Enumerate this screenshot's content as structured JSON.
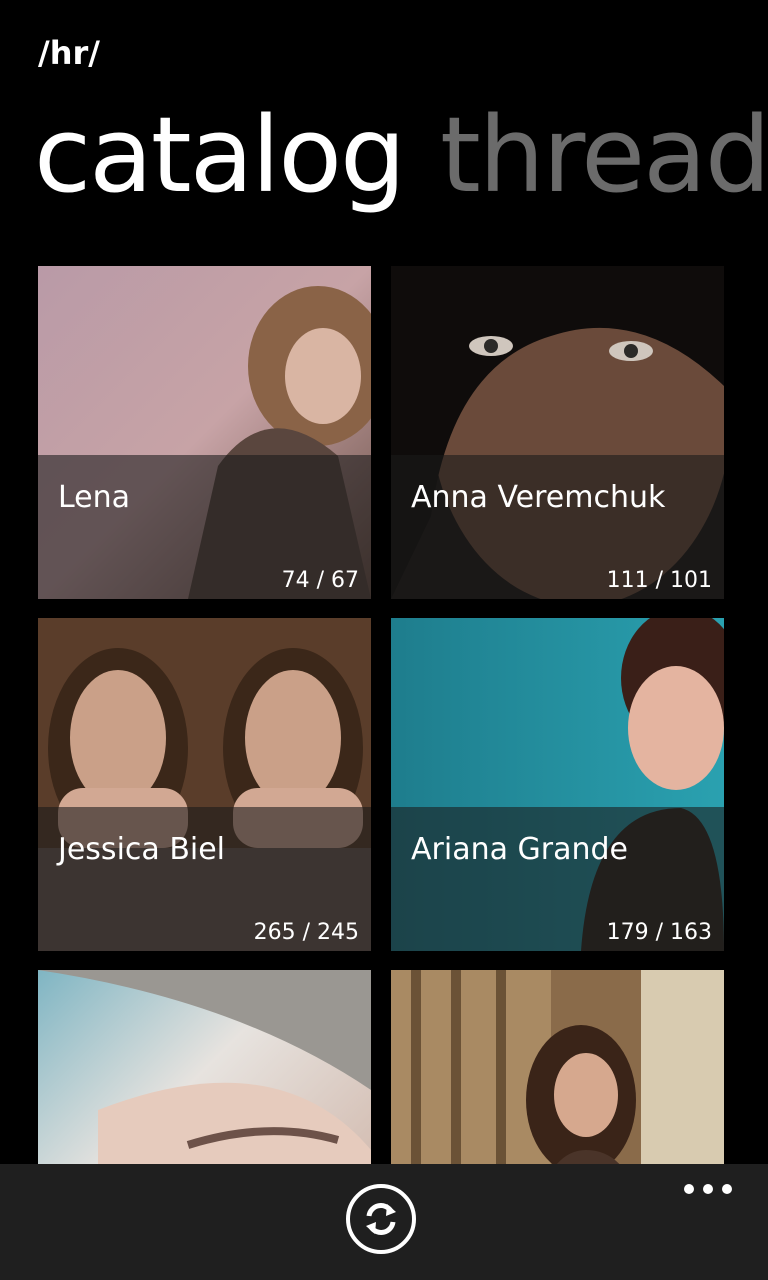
{
  "header": {
    "board": "/hr/"
  },
  "pivot": {
    "tabs": [
      {
        "label": "catalog"
      },
      {
        "label": "threads"
      }
    ]
  },
  "catalog": {
    "threads": [
      {
        "title": "Lena",
        "counts": "74 / 67"
      },
      {
        "title": "Anna Veremchuk",
        "counts": "111 / 101"
      },
      {
        "title": "Jessica Biel",
        "counts": "265 / 245"
      },
      {
        "title": "Ariana Grande",
        "counts": "179 / 163"
      },
      {
        "title": "",
        "counts": ""
      },
      {
        "title": "",
        "counts": ""
      }
    ]
  },
  "app_bar": {
    "refresh_icon": "refresh-icon",
    "more_icon": "more-icon",
    "background": "#1f1f1f"
  }
}
